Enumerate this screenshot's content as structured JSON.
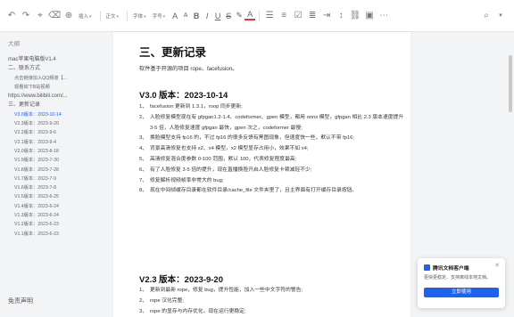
{
  "toolbar": {
    "style_label": "正文",
    "font_label": "字体",
    "size_label": "字号",
    "insert_label": "插入",
    "colors": {
      "primary": "#1d63f2"
    }
  },
  "sidebar": {
    "title": "大纲",
    "items": [
      {
        "label": "mac苹果电脑版V1.4",
        "level": 1
      },
      {
        "label": "二、联系方式",
        "level": 1
      },
      {
        "label": "点击链接加入QQ频道【...",
        "level": 2
      },
      {
        "label": "观看如下B站视频",
        "level": 2
      },
      {
        "label": "https://www.bilibili.com/...",
        "level": 1
      },
      {
        "label": "三、更新记录",
        "level": 1
      },
      {
        "label": "V3.0版本：2023-10-14",
        "level": 2,
        "active": true
      },
      {
        "label": "V2.3版本：2023-9-20",
        "level": 2
      },
      {
        "label": "V2.2版本：2023-9-6",
        "level": 2
      },
      {
        "label": "V2.1版本：2023-9-4",
        "level": 2
      },
      {
        "label": "V2.0版本：2023-8-18",
        "level": 2
      },
      {
        "label": "V1.9版本：2023-7-30",
        "level": 2
      },
      {
        "label": "V1.8版本：2023-7-28",
        "level": 2
      },
      {
        "label": "V1.7版本：2023-7-9",
        "level": 2
      },
      {
        "label": "V1.6版本：2023-7-8",
        "level": 2
      },
      {
        "label": "V1.5版本：2023-6-25",
        "level": 2
      },
      {
        "label": "V1.4版本：2023-6-24",
        "level": 2
      },
      {
        "label": "V1.3版本：2023-6-24",
        "level": 2
      },
      {
        "label": "V1.2版本：2023-6-23",
        "level": 2
      },
      {
        "label": "V1.1版本：2023-6-23",
        "level": 2
      }
    ],
    "footer": "免责声明"
  },
  "document": {
    "heading": "三、更新记录",
    "intro": "软件基于开源的项目 rope、facefusion。",
    "sections": [
      {
        "title": "V3.0 版本：2023-10-14",
        "items": [
          "facefusion 更新到 1.3.1，roop 同步更新;",
          "人脸修复模型现在有 gfpgan1.2-1.4、codeformer、gpen 模型，都用 onnx 模型，gfpgan 相比 2.3 版本速度提升 3-5 倍，人脸修复速度 gfpgan 最快，gpen 次之，codeformer 最慢;",
          "换脸模型支持 fp16 的，不过 fp16 的很多反馈有黑图现象，但速度快一些，默认不带 fp16;",
          "背景高清修复也支持 x2、x4 模型，x2 模型显存占用小，效果不如 x4;",
          "高清修复混合度参数 0-100 范围，默认 100，代表修复程度最高;",
          "有了人脸修复 3-5 倍的提升，现在直播换脸开启人脸修复卡顿减轻不少;",
          "修复解析视频帧率非常大的 bug;",
          "现在中间帧缓存目录都在软件目录/cache_file 文件夹里了，且主界面有打开缓存目录按钮。"
        ]
      },
      {
        "title": "V2.3 版本：2023-9-20",
        "items": [
          "更新到最新 rope，修复 bug，提升性能，加入一些中文字符的警告;",
          "rope 汉化完整;",
          "rope 的显存与内存优化，现在运行更稳定;"
        ]
      }
    ]
  },
  "popup": {
    "title": "腾讯文档客户端",
    "desc": "更快更稳定、支持离线本地文档。",
    "button": "立即使用",
    "close": "✕"
  }
}
